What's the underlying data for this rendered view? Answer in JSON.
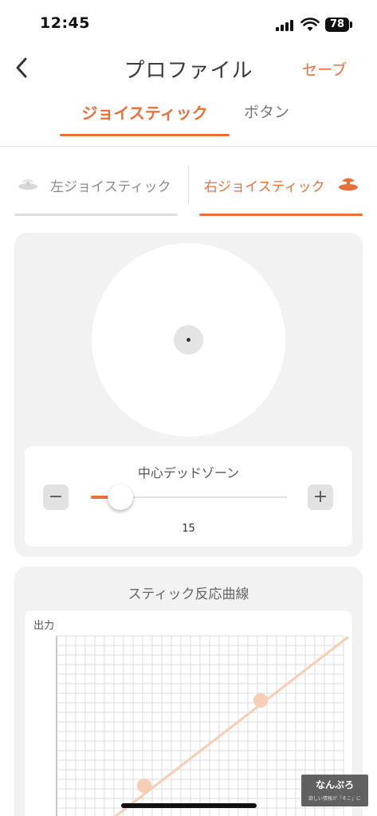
{
  "status_bar": {
    "time": "12:45",
    "battery": "78"
  },
  "nav": {
    "title": "プロファイル",
    "save": "セーブ"
  },
  "top_tabs": [
    {
      "label": "ジョイスティック",
      "active": true
    },
    {
      "label": "ボタン",
      "active": false
    }
  ],
  "sub_tabs": [
    {
      "label": "左ジョイスティック",
      "active": false
    },
    {
      "label": "右ジョイスティック",
      "active": true
    }
  ],
  "deadzone": {
    "title": "中心デッドゾーン",
    "minus": "−",
    "plus": "+",
    "value": "15"
  },
  "curve": {
    "title": "スティック反応曲線",
    "y_label": "出力"
  },
  "watermark": {
    "title": "なんぷろ",
    "subtitle": "欲しい情報が「そこ」に"
  },
  "colors": {
    "accent": "#ec6e3a",
    "curve": "#f6cdb5",
    "card": "#f2f2f2"
  }
}
